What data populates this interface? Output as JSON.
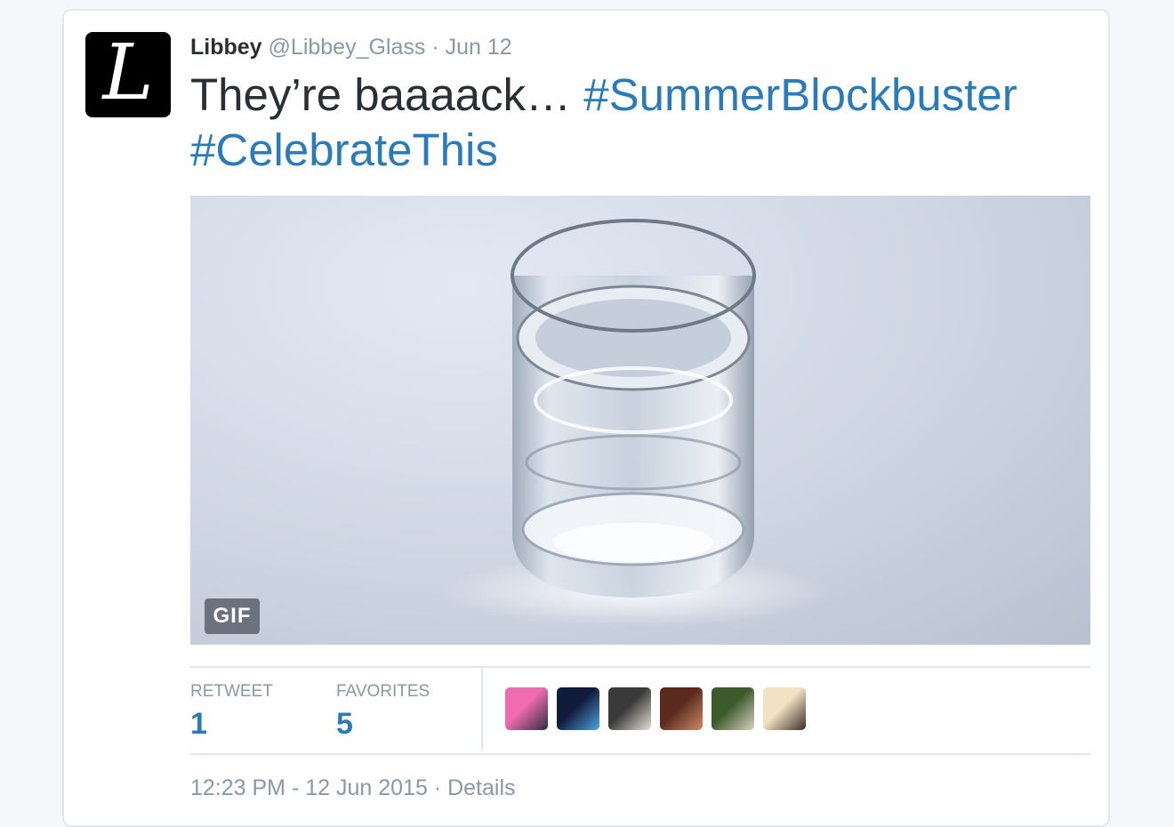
{
  "tweet": {
    "author_name": "Libbey",
    "author_handle": "@Libbey_Glass",
    "separator": "·",
    "date": "Jun 12",
    "avatar_letter": "L",
    "text_plain": "They’re baaaack… ",
    "hashtag_1": "#SummerBlockbuster",
    "hashtag_2": "#CelebrateThis",
    "media_badge": "GIF"
  },
  "stats": {
    "retweet_label": "RETWEET",
    "retweet_count": "1",
    "favorites_label": "FAVORITES",
    "favorites_count": "5"
  },
  "favoriters": [
    {
      "icon": "favoriter-avatar-1",
      "colors": [
        "#f06bb0",
        "#2a2f3a"
      ]
    },
    {
      "icon": "favoriter-avatar-2",
      "colors": [
        "#101a3a",
        "#4fa3e0"
      ]
    },
    {
      "icon": "favoriter-avatar-3",
      "colors": [
        "#3a3a3a",
        "#e8e0d6"
      ]
    },
    {
      "icon": "favoriter-avatar-4",
      "colors": [
        "#5a2a1e",
        "#d08a6a"
      ]
    },
    {
      "icon": "favoriter-avatar-5",
      "colors": [
        "#3d5a2a",
        "#d9d0c2"
      ]
    },
    {
      "icon": "favoriter-avatar-6",
      "colors": [
        "#f1e2c4",
        "#3a2e28"
      ]
    }
  ],
  "footer": {
    "timestamp": "12:23 PM - 12 Jun 2015",
    "separator": " · ",
    "details": "Details"
  },
  "colors": {
    "link": "#2b7bb9",
    "muted": "#8899a6",
    "text": "#292f33"
  }
}
